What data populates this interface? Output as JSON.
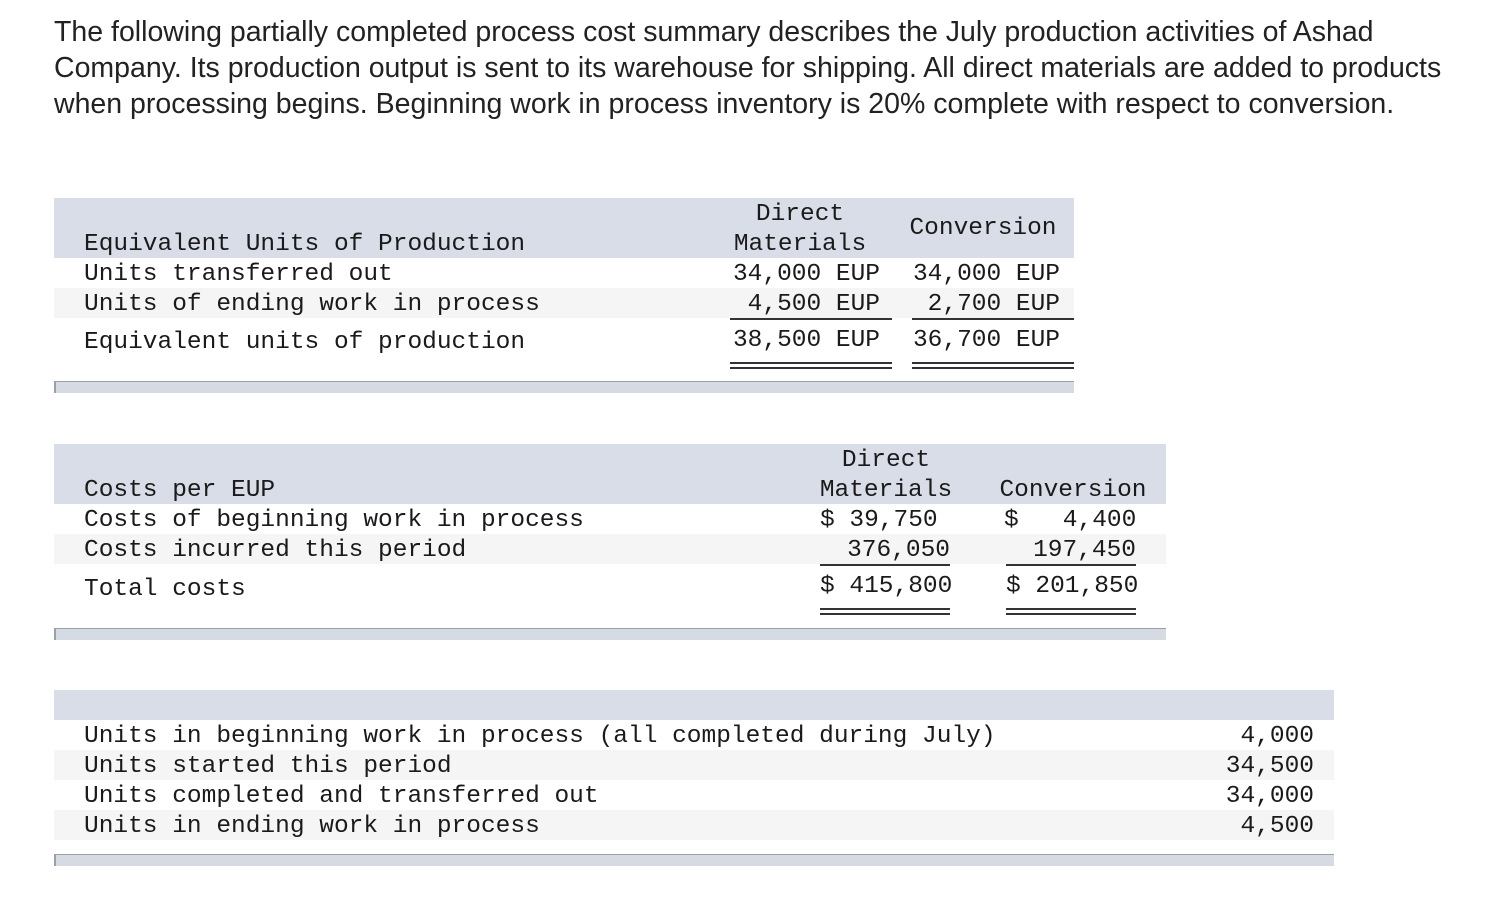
{
  "intro": "The following partially completed process cost summary describes the July production activities of Ashad Company. Its production output is sent to its warehouse for shipping. All direct materials are added to products when processing begins. Beginning work in process inventory is 20% complete with respect to conversion.",
  "eup": {
    "title": "Equivalent Units of Production",
    "col1_line1": "Direct",
    "col1_line2": "Materials",
    "col2": "Conversion",
    "rows": [
      {
        "label": "Units transferred out",
        "dm": "34,000 EUP",
        "conv": "34,000 EUP"
      },
      {
        "label": "Units of ending work in process",
        "dm": "4,500 EUP",
        "conv": "2,700 EUP"
      }
    ],
    "total": {
      "label": "Equivalent units of production",
      "dm": "38,500 EUP",
      "conv": "36,700 EUP"
    }
  },
  "costs": {
    "title": "Costs per EUP",
    "col1_line1": "Direct",
    "col1_line2": "Materials",
    "col2": "Conversion",
    "rows": [
      {
        "label": "Costs of beginning work in process",
        "dm": "$ 39,750",
        "conv": "$   4,400"
      },
      {
        "label": "Costs incurred this period",
        "dm": "376,050",
        "conv": "197,450"
      }
    ],
    "total": {
      "label": "Total costs",
      "dm": "$ 415,800",
      "conv": "$ 201,850"
    }
  },
  "units": {
    "rows": [
      {
        "label": "Units in beginning work in process (all completed during July)",
        "value": "4,000"
      },
      {
        "label": "Units started this period",
        "value": "34,500"
      },
      {
        "label": "Units completed and transferred out",
        "value": "34,000"
      },
      {
        "label": "Units in ending work in process",
        "value": "4,500"
      }
    ]
  }
}
